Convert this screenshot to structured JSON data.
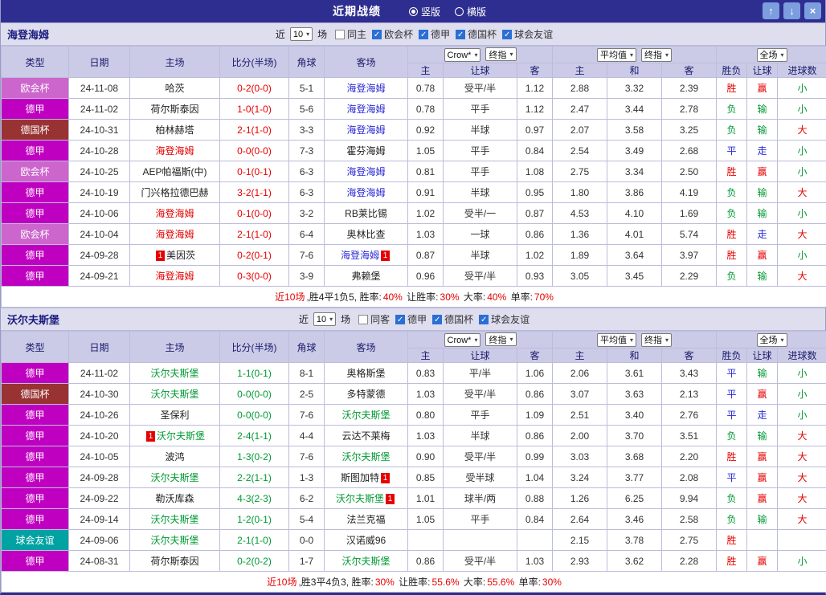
{
  "titlebar": {
    "title": "近期战绩",
    "bg_color": "#2e2e90",
    "layout_options": [
      {
        "label": "竖版",
        "selected": true
      },
      {
        "label": "横版",
        "selected": false
      }
    ],
    "buttons": [
      {
        "name": "move-up",
        "glyph": "↑"
      },
      {
        "name": "move-down",
        "glyph": "↓"
      },
      {
        "name": "close",
        "glyph": "×"
      }
    ]
  },
  "table_header": {
    "static_cols": [
      "类型",
      "日期",
      "主场",
      "比分(半场)",
      "角球",
      "客场"
    ],
    "groups": [
      {
        "selects": [
          "Crow*",
          "终指"
        ],
        "cols": [
          "主",
          "让球",
          "客"
        ]
      },
      {
        "selects": [
          "平均值",
          "终指"
        ],
        "cols": [
          "主",
          "和",
          "客"
        ]
      },
      {
        "selects": [
          "全场"
        ],
        "cols": [
          "胜负",
          "让球",
          "进球数"
        ]
      }
    ]
  },
  "league_colors": {
    "欧会杯": "#cc66cc",
    "德甲": "#c000c0",
    "德国杯": "#993333",
    "球会友谊": "#00a2a2"
  },
  "result_colors": {
    "胜": "#e60000",
    "平": "#2929d6",
    "负": "#009933",
    "赢": "#e60000",
    "走": "#2929d6",
    "输": "#009933",
    "大": "#e60000",
    "小": "#009933"
  },
  "sections": [
    {
      "team": "海登海姆",
      "score_color": "#e60000",
      "focal_home_color": "#e60000",
      "focal_away_color": "#2929d6",
      "filters": {
        "near_label": "近",
        "count": "10",
        "games_label": "场",
        "checkboxes": [
          {
            "label": "同主",
            "checked": false
          },
          {
            "label": "欧会杯",
            "checked": true
          },
          {
            "label": "德甲",
            "checked": true
          },
          {
            "label": "德国杯",
            "checked": true
          },
          {
            "label": "球会友谊",
            "checked": true
          }
        ]
      },
      "rows": [
        {
          "league": "欧会杯",
          "date": "24-11-08",
          "home": "哈茨",
          "score": "0-2(0-0)",
          "corners": "5-1",
          "away": "海登海姆",
          "away_focal": true,
          "o1": "0.78",
          "hcap": "受平/半",
          "o2": "1.12",
          "a1": "2.88",
          "a2": "3.32",
          "a3": "2.39",
          "r1": "胜",
          "r2": "赢",
          "r3": "小"
        },
        {
          "league": "德甲",
          "date": "24-11-02",
          "home": "荷尔斯泰因",
          "score": "1-0(1-0)",
          "corners": "5-6",
          "away": "海登海姆",
          "away_focal": true,
          "o1": "0.78",
          "hcap": "平手",
          "o2": "1.12",
          "a1": "2.47",
          "a2": "3.44",
          "a3": "2.78",
          "r1": "负",
          "r2": "输",
          "r3": "小"
        },
        {
          "league": "德国杯",
          "date": "24-10-31",
          "home": "柏林赫塔",
          "score": "2-1(1-0)",
          "corners": "3-3",
          "away": "海登海姆",
          "away_focal": true,
          "o1": "0.92",
          "hcap": "半球",
          "o2": "0.97",
          "a1": "2.07",
          "a2": "3.58",
          "a3": "3.25",
          "r1": "负",
          "r2": "输",
          "r3": "大"
        },
        {
          "league": "德甲",
          "date": "24-10-28",
          "home": "海登海姆",
          "home_focal": true,
          "score": "0-0(0-0)",
          "corners": "7-3",
          "away": "霍芬海姆",
          "o1": "1.05",
          "hcap": "平手",
          "o2": "0.84",
          "a1": "2.54",
          "a2": "3.49",
          "a3": "2.68",
          "r1": "平",
          "r2": "走",
          "r3": "小"
        },
        {
          "league": "欧会杯",
          "date": "24-10-25",
          "home": "AEP帕福斯(中)",
          "score": "0-1(0-1)",
          "corners": "6-3",
          "away": "海登海姆",
          "away_focal": true,
          "o1": "0.81",
          "hcap": "平手",
          "o2": "1.08",
          "a1": "2.75",
          "a2": "3.34",
          "a3": "2.50",
          "r1": "胜",
          "r2": "赢",
          "r3": "小"
        },
        {
          "league": "德甲",
          "date": "24-10-19",
          "home": "门兴格拉德巴赫",
          "score": "3-2(1-1)",
          "corners": "6-3",
          "away": "海登海姆",
          "away_focal": true,
          "o1": "0.91",
          "hcap": "半球",
          "o2": "0.95",
          "a1": "1.80",
          "a2": "3.86",
          "a3": "4.19",
          "r1": "负",
          "r2": "输",
          "r3": "大"
        },
        {
          "league": "德甲",
          "date": "24-10-06",
          "home": "海登海姆",
          "home_focal": true,
          "score": "0-1(0-0)",
          "corners": "3-2",
          "away": "RB莱比锡",
          "o1": "1.02",
          "hcap": "受半/一",
          "o2": "0.87",
          "a1": "4.53",
          "a2": "4.10",
          "a3": "1.69",
          "r1": "负",
          "r2": "输",
          "r3": "小"
        },
        {
          "league": "欧会杯",
          "date": "24-10-04",
          "home": "海登海姆",
          "home_focal": true,
          "score": "2-1(1-0)",
          "corners": "6-4",
          "away": "奥林比查",
          "o1": "1.03",
          "hcap": "一球",
          "o2": "0.86",
          "a1": "1.36",
          "a2": "4.01",
          "a3": "5.74",
          "r1": "胜",
          "r2": "走",
          "r3": "大"
        },
        {
          "league": "德甲",
          "date": "24-09-28",
          "home": "美因茨",
          "home_card": true,
          "score": "0-2(0-1)",
          "corners": "7-6",
          "away": "海登海姆",
          "away_focal": true,
          "away_card": true,
          "o1": "0.87",
          "hcap": "半球",
          "o2": "1.02",
          "a1": "1.89",
          "a2": "3.64",
          "a3": "3.97",
          "r1": "胜",
          "r2": "赢",
          "r3": "小"
        },
        {
          "league": "德甲",
          "date": "24-09-21",
          "home": "海登海姆",
          "home_focal": true,
          "score": "0-3(0-0)",
          "corners": "3-9",
          "away": "弗赖堡",
          "o1": "0.96",
          "hcap": "受平/半",
          "o2": "0.93",
          "a1": "3.05",
          "a2": "3.45",
          "a3": "2.29",
          "r1": "负",
          "r2": "输",
          "r3": "大"
        }
      ],
      "summary": [
        {
          "t": "近10场",
          "red": true
        },
        {
          "t": ",胜4平1负5, 胜率:",
          "red": false
        },
        {
          "t": "40%",
          "red": true
        },
        {
          "t": " 让胜率:",
          "red": false
        },
        {
          "t": "30%",
          "red": true
        },
        {
          "t": " 大率:",
          "red": false
        },
        {
          "t": "40%",
          "red": true
        },
        {
          "t": " 单率:",
          "red": false
        },
        {
          "t": "70%",
          "red": true
        }
      ]
    },
    {
      "team": "沃尔夫斯堡",
      "score_color": "#009933",
      "focal_home_color": "#009933",
      "focal_away_color": "#009933",
      "filters": {
        "near_label": "近",
        "count": "10",
        "games_label": "场",
        "checkboxes": [
          {
            "label": "同客",
            "checked": false
          },
          {
            "label": "德甲",
            "checked": true
          },
          {
            "label": "德国杯",
            "checked": true
          },
          {
            "label": "球会友谊",
            "checked": true
          }
        ]
      },
      "rows": [
        {
          "league": "德甲",
          "date": "24-11-02",
          "home": "沃尔夫斯堡",
          "home_focal": true,
          "score": "1-1(0-1)",
          "corners": "8-1",
          "away": "奥格斯堡",
          "o1": "0.83",
          "hcap": "平/半",
          "o2": "1.06",
          "a1": "2.06",
          "a2": "3.61",
          "a3": "3.43",
          "r1": "平",
          "r2": "输",
          "r3": "小"
        },
        {
          "league": "德国杯",
          "date": "24-10-30",
          "home": "沃尔夫斯堡",
          "home_focal": true,
          "score": "0-0(0-0)",
          "corners": "2-5",
          "away": "多特蒙德",
          "o1": "1.03",
          "hcap": "受平/半",
          "o2": "0.86",
          "a1": "3.07",
          "a2": "3.63",
          "a3": "2.13",
          "r1": "平",
          "r2": "赢",
          "r3": "小"
        },
        {
          "league": "德甲",
          "date": "24-10-26",
          "home": "圣保利",
          "score": "0-0(0-0)",
          "corners": "7-6",
          "away": "沃尔夫斯堡",
          "away_focal": true,
          "o1": "0.80",
          "hcap": "平手",
          "o2": "1.09",
          "a1": "2.51",
          "a2": "3.40",
          "a3": "2.76",
          "r1": "平",
          "r2": "走",
          "r3": "小"
        },
        {
          "league": "德甲",
          "date": "24-10-20",
          "home": "沃尔夫斯堡",
          "home_focal": true,
          "home_card": true,
          "score": "2-4(1-1)",
          "corners": "4-4",
          "away": "云达不莱梅",
          "o1": "1.03",
          "hcap": "半球",
          "o2": "0.86",
          "a1": "2.00",
          "a2": "3.70",
          "a3": "3.51",
          "r1": "负",
          "r2": "输",
          "r3": "大"
        },
        {
          "league": "德甲",
          "date": "24-10-05",
          "home": "波鸿",
          "score": "1-3(0-2)",
          "corners": "7-6",
          "away": "沃尔夫斯堡",
          "away_focal": true,
          "o1": "0.90",
          "hcap": "受平/半",
          "o2": "0.99",
          "a1": "3.03",
          "a2": "3.68",
          "a3": "2.20",
          "r1": "胜",
          "r2": "赢",
          "r3": "大"
        },
        {
          "league": "德甲",
          "date": "24-09-28",
          "home": "沃尔夫斯堡",
          "home_focal": true,
          "score": "2-2(1-1)",
          "corners": "1-3",
          "away": "斯图加特",
          "away_card": true,
          "o1": "0.85",
          "hcap": "受半球",
          "o2": "1.04",
          "a1": "3.24",
          "a2": "3.77",
          "a3": "2.08",
          "r1": "平",
          "r2": "赢",
          "r3": "大"
        },
        {
          "league": "德甲",
          "date": "24-09-22",
          "home": "勒沃库森",
          "score": "4-3(2-3)",
          "corners": "6-2",
          "away": "沃尔夫斯堡",
          "away_focal": true,
          "away_card": true,
          "o1": "1.01",
          "hcap": "球半/两",
          "o2": "0.88",
          "a1": "1.26",
          "a2": "6.25",
          "a3": "9.94",
          "r1": "负",
          "r2": "赢",
          "r3": "大"
        },
        {
          "league": "德甲",
          "date": "24-09-14",
          "home": "沃尔夫斯堡",
          "home_focal": true,
          "score": "1-2(0-1)",
          "corners": "5-4",
          "away": "法兰克福",
          "o1": "1.05",
          "hcap": "平手",
          "o2": "0.84",
          "a1": "2.64",
          "a2": "3.46",
          "a3": "2.58",
          "r1": "负",
          "r2": "输",
          "r3": "大"
        },
        {
          "league": "球会友谊",
          "date": "24-09-06",
          "home": "沃尔夫斯堡",
          "home_focal": true,
          "score": "2-1(1-0)",
          "corners": "0-0",
          "away": "汉诺威96",
          "o1": "",
          "hcap": "",
          "o2": "",
          "a1": "2.15",
          "a2": "3.78",
          "a3": "2.75",
          "r1": "胜",
          "r2": "",
          "r3": ""
        },
        {
          "league": "德甲",
          "date": "24-08-31",
          "home": "荷尔斯泰因",
          "score": "0-2(0-2)",
          "corners": "1-7",
          "away": "沃尔夫斯堡",
          "away_focal": true,
          "o1": "0.86",
          "hcap": "受平/半",
          "o2": "1.03",
          "a1": "2.93",
          "a2": "3.62",
          "a3": "2.28",
          "r1": "胜",
          "r2": "赢",
          "r3": "小"
        }
      ],
      "summary": [
        {
          "t": "近10场",
          "red": true
        },
        {
          "t": ",胜3平4负3, 胜率:",
          "red": false
        },
        {
          "t": "30%",
          "red": true
        },
        {
          "t": " 让胜率:",
          "red": false
        },
        {
          "t": "55.6%",
          "red": true
        },
        {
          "t": " 大率:",
          "red": false
        },
        {
          "t": "55.6%",
          "red": true
        },
        {
          "t": " 单率:",
          "red": false
        },
        {
          "t": "30%",
          "red": true
        }
      ]
    }
  ]
}
